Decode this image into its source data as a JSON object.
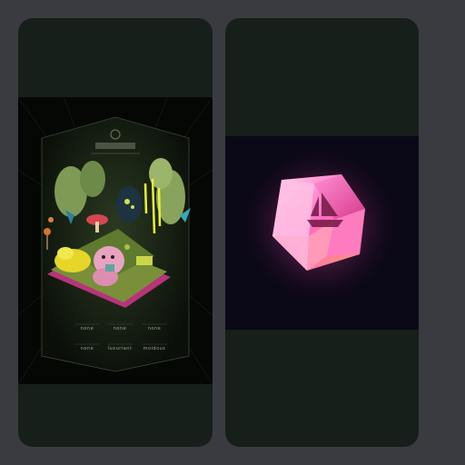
{
  "left_card": {
    "stats_row1": [
      "none",
      "none",
      "none"
    ],
    "stats_row2": [
      "none",
      "luxuriant",
      "moldous"
    ]
  },
  "right_card": {
    "icon": "ship-icon"
  },
  "colors": {
    "page_bg": "#3a3b40",
    "card_bg": "#161f1a",
    "art_bg": "#050705",
    "gem_bg": "#0b0817",
    "gem_pink": "#ff5fb8"
  }
}
